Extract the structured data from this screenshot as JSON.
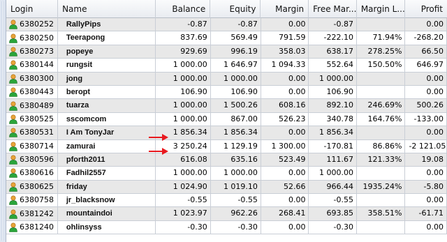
{
  "columns": {
    "login": "Login",
    "name": "Name",
    "balance": "Balance",
    "equity": "Equity",
    "margin": "Margin",
    "free_margin": "Free Mar...",
    "margin_level": "Margin L...",
    "profit": "Profit"
  },
  "colors": {
    "arrow": "#e8191f",
    "row_alt": "#e8e8e8",
    "icon_head": "#e8a43a",
    "icon_body": "#2aa53a"
  },
  "icons": {
    "user": "user-icon",
    "arrow": "red-arrow-icon"
  },
  "rows": [
    {
      "login": "6380252",
      "name": "RallyPips",
      "balance": "-0.87",
      "equity": "-0.87",
      "margin": "0.00",
      "free_margin": "-0.87",
      "margin_level": "",
      "profit": "0.00"
    },
    {
      "login": "6380250",
      "name": "Teerapong",
      "balance": "837.69",
      "equity": "569.49",
      "margin": "791.59",
      "free_margin": "-222.10",
      "margin_level": "71.94%",
      "profit": "-268.20"
    },
    {
      "login": "6380273",
      "name": "popeye",
      "balance": "929.69",
      "equity": "996.19",
      "margin": "358.03",
      "free_margin": "638.17",
      "margin_level": "278.25%",
      "profit": "66.50"
    },
    {
      "login": "6380144",
      "name": "rungsit",
      "balance": "1 000.00",
      "equity": "1 646.97",
      "margin": "1 094.33",
      "free_margin": "552.64",
      "margin_level": "150.50%",
      "profit": "646.97"
    },
    {
      "login": "6380300",
      "name": "jong",
      "balance": "1 000.00",
      "equity": "1 000.00",
      "margin": "0.00",
      "free_margin": "1 000.00",
      "margin_level": "",
      "profit": "0.00"
    },
    {
      "login": "6380443",
      "name": "beropt",
      "balance": "106.90",
      "equity": "106.90",
      "margin": "0.00",
      "free_margin": "106.90",
      "margin_level": "",
      "profit": "0.00"
    },
    {
      "login": "6380489",
      "name": "tuarza",
      "balance": "1 000.00",
      "equity": "1 500.26",
      "margin": "608.16",
      "free_margin": "892.10",
      "margin_level": "246.69%",
      "profit": "500.26"
    },
    {
      "login": "6380525",
      "name": "sscomcom",
      "balance": "1 000.00",
      "equity": "867.00",
      "margin": "526.23",
      "free_margin": "340.78",
      "margin_level": "164.76%",
      "profit": "-133.00"
    },
    {
      "login": "6380531",
      "name": "I Am TonyJar",
      "balance": "1 856.34",
      "equity": "1 856.34",
      "margin": "0.00",
      "free_margin": "1 856.34",
      "margin_level": "",
      "profit": "0.00"
    },
    {
      "login": "6380714",
      "name": "zamurai",
      "balance": "3 250.24",
      "equity": "1 129.19",
      "margin": "1 300.00",
      "free_margin": "-170.81",
      "margin_level": "86.86%",
      "profit": "-2 121.05"
    },
    {
      "login": "6380596",
      "name": "pforth2011",
      "balance": "616.08",
      "equity": "635.16",
      "margin": "523.49",
      "free_margin": "111.67",
      "margin_level": "121.33%",
      "profit": "19.08"
    },
    {
      "login": "6380616",
      "name": "Fadhil2557",
      "balance": "1 000.00",
      "equity": "1 000.00",
      "margin": "0.00",
      "free_margin": "1 000.00",
      "margin_level": "",
      "profit": "0.00"
    },
    {
      "login": "6380625",
      "name": "friday",
      "balance": "1 024.90",
      "equity": "1 019.10",
      "margin": "52.66",
      "free_margin": "966.44",
      "margin_level": "1935.24%",
      "profit": "-5.80"
    },
    {
      "login": "6380758",
      "name": "jr_blacksnow",
      "balance": "-0.55",
      "equity": "-0.55",
      "margin": "0.00",
      "free_margin": "-0.55",
      "margin_level": "",
      "profit": "0.00"
    },
    {
      "login": "6381242",
      "name": "mountaindoi",
      "balance": "1 023.97",
      "equity": "962.26",
      "margin": "268.41",
      "free_margin": "693.85",
      "margin_level": "358.51%",
      "profit": "-61.71"
    },
    {
      "login": "6381240",
      "name": "ohlinsyss",
      "balance": "-0.30",
      "equity": "-0.30",
      "margin": "0.00",
      "free_margin": "-0.30",
      "margin_level": "",
      "profit": "0.00"
    }
  ]
}
